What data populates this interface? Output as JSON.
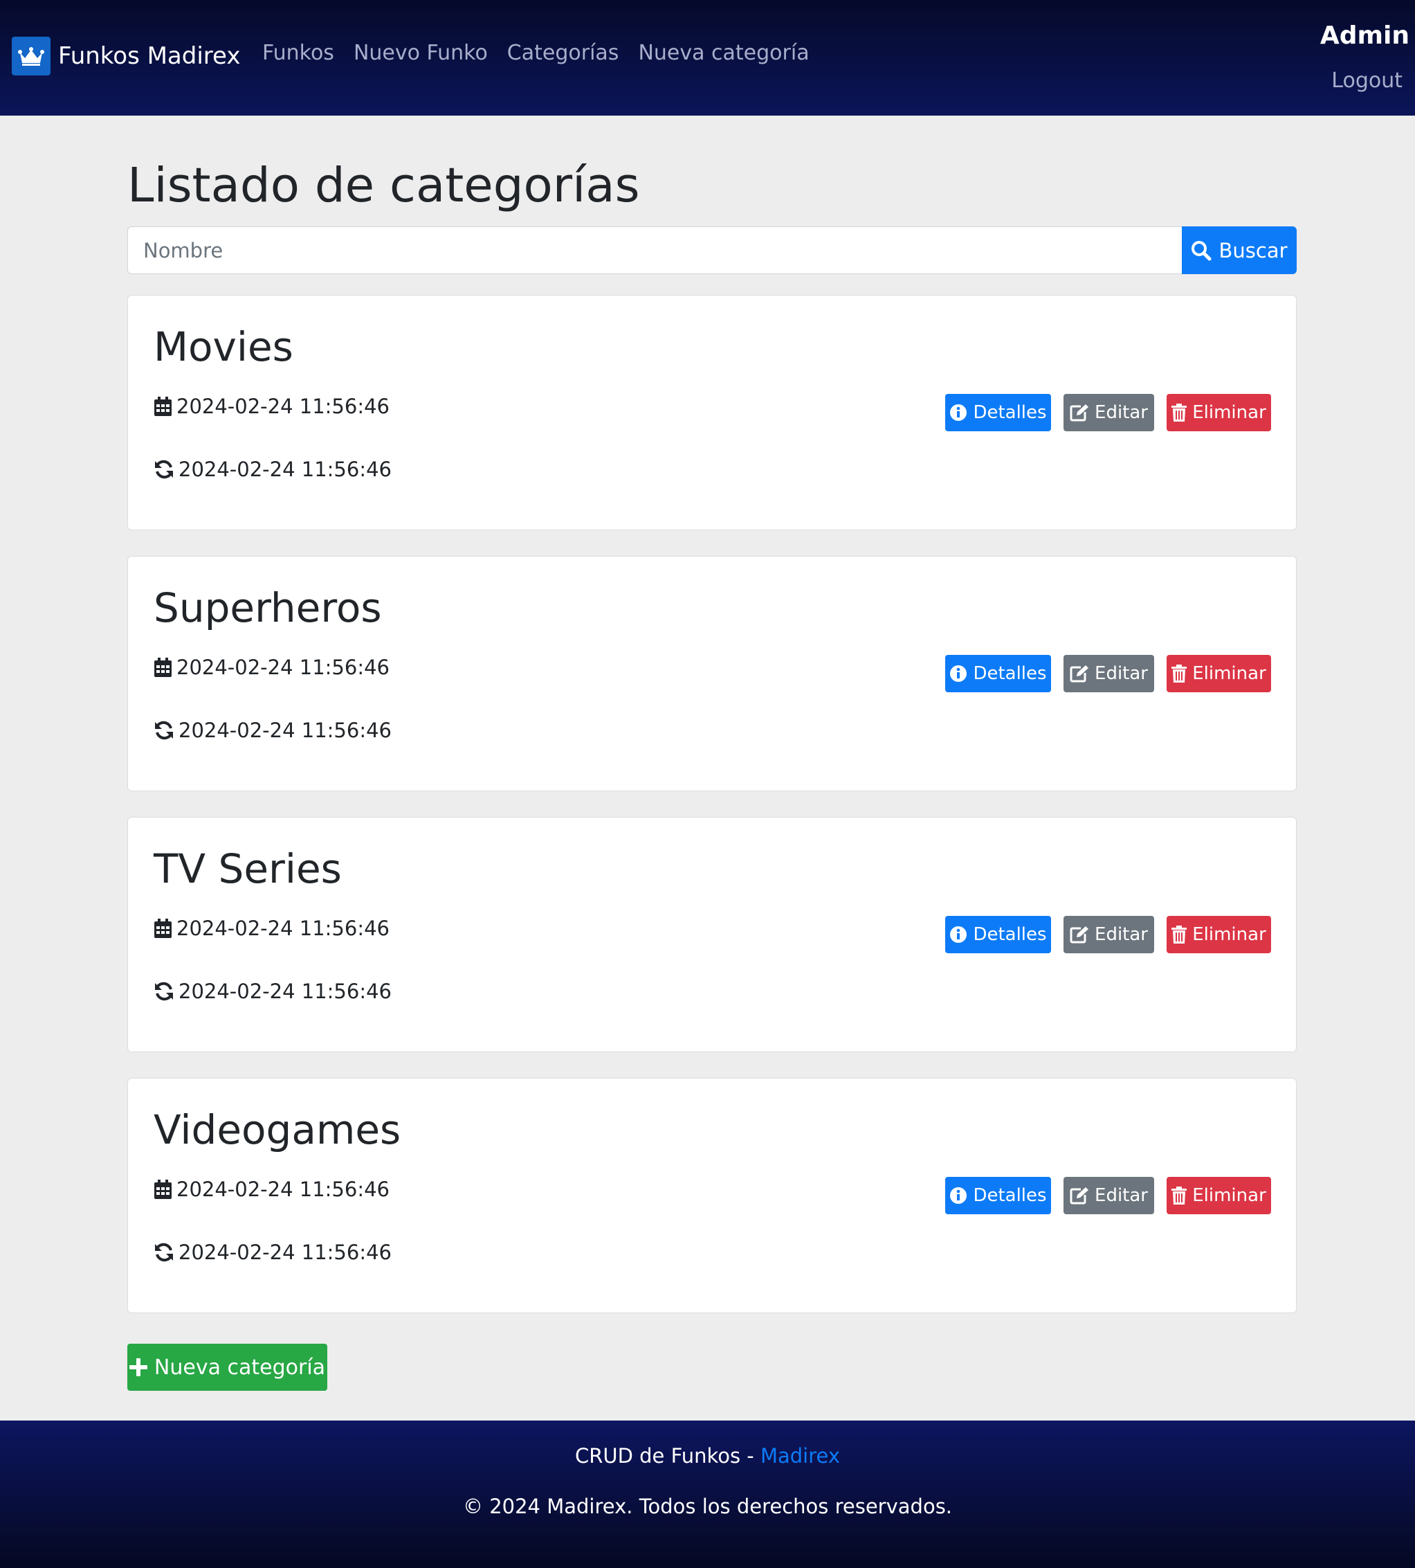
{
  "brand": {
    "name": "Funkos Madirex",
    "logo_icon": "crown-icon",
    "accent": "#1466c8"
  },
  "nav": {
    "links": [
      {
        "label": "Funkos"
      },
      {
        "label": "Nuevo Funko"
      },
      {
        "label": "Categorías"
      },
      {
        "label": "Nueva categoría"
      }
    ],
    "user": "Admin",
    "logout": "Logout"
  },
  "page": {
    "title": "Listado de categorías",
    "search": {
      "placeholder": "Nombre",
      "value": "",
      "button_label": "Buscar",
      "button_icon": "search-icon"
    }
  },
  "categories": [
    {
      "name": "Movies",
      "created": "2024-02-24 11:56:46",
      "updated": "2024-02-24 11:56:46"
    },
    {
      "name": "Superheros",
      "created": "2024-02-24 11:56:46",
      "updated": "2024-02-24 11:56:46"
    },
    {
      "name": "TV Series",
      "created": "2024-02-24 11:56:46",
      "updated": "2024-02-24 11:56:46"
    },
    {
      "name": "Videogames",
      "created": "2024-02-24 11:56:46",
      "updated": "2024-02-24 11:56:46"
    }
  ],
  "card_actions": {
    "details": "Detalles",
    "edit": "Editar",
    "delete": "Eliminar"
  },
  "new_category_button": "Nueva categoría",
  "footer": {
    "prefix": "CRUD de Funkos - ",
    "link": "Madirex",
    "copyright": "© 2024 Madirex. Todos los derechos reservados."
  },
  "colors": {
    "primary": "#0d7bf7",
    "secondary": "#6c757d",
    "danger": "#dc3545",
    "success": "#28a745",
    "navbar": "#0b1559"
  }
}
